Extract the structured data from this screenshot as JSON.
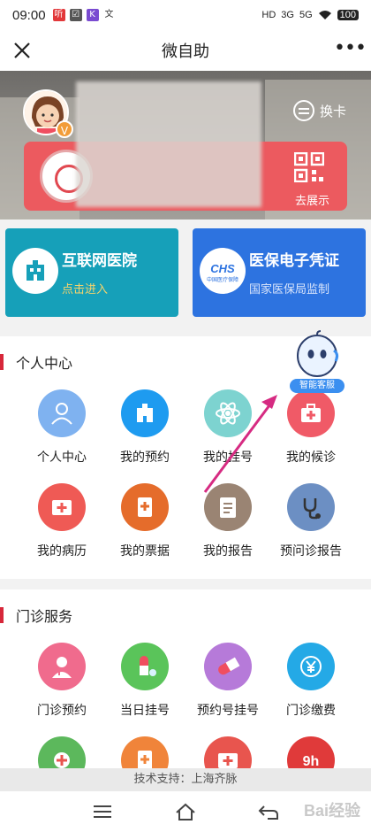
{
  "status_bar": {
    "time": "09:00",
    "notification_icons": [
      "听",
      "☑",
      "K",
      "文"
    ],
    "signal_labels": [
      "HD",
      "3G",
      "5G"
    ],
    "battery": "100"
  },
  "title_bar": {
    "title": "微自助",
    "more_label": "•••"
  },
  "hero": {
    "switch_card_label": "换卡",
    "show_qr_label": "去展示",
    "vip_badge": "V"
  },
  "tiles": [
    {
      "title": "互联网医院",
      "subtitle": "点击进入",
      "logo_text": "",
      "color": "#16a0b9"
    },
    {
      "title": "医保电子凭证",
      "subtitle": "国家医保局监制",
      "logo_text": "CHS",
      "logo_caption": "中国医疗保障",
      "color": "#2d73e0"
    }
  ],
  "personal_center": {
    "heading": "个人中心",
    "items": [
      {
        "label": "个人中心",
        "icon": "user-icon",
        "color": "#7fb2f0"
      },
      {
        "label": "我的预约",
        "icon": "hospital-building-icon",
        "color": "#1e9bf0"
      },
      {
        "label": "我的挂号",
        "icon": "atom-icon",
        "color": "#7dd3d0"
      },
      {
        "label": "我的候诊",
        "icon": "medical-kit-icon",
        "color": "#f05a67"
      },
      {
        "label": "我的病历",
        "icon": "medical-record-icon",
        "color": "#ef5a55"
      },
      {
        "label": "我的票据",
        "icon": "receipt-icon",
        "color": "#e56c2b"
      },
      {
        "label": "我的报告",
        "icon": "report-clipboard-icon",
        "color": "#9a8473"
      },
      {
        "label": "预问诊报告",
        "icon": "stethoscope-icon",
        "color": "#6c8fc3"
      }
    ]
  },
  "outpatient_service": {
    "heading": "门诊服务",
    "items": [
      {
        "label": "门诊预约",
        "icon": "doctor-icon",
        "color": "#f06b8d"
      },
      {
        "label": "当日挂号",
        "icon": "pill-icon",
        "color": "#5ac45a"
      },
      {
        "label": "预约号挂号",
        "icon": "capsule-icon",
        "color": "#b67ad9"
      },
      {
        "label": "门诊缴费",
        "icon": "yuan-coin-icon",
        "color": "#24a9e6"
      },
      {
        "label": "",
        "icon": "health-care-icon",
        "color": "#5cb85c"
      },
      {
        "label": "",
        "icon": "clipboard-plus-icon",
        "color": "#f0843a"
      },
      {
        "label": "",
        "icon": "first-aid-icon",
        "color": "#e8554e"
      },
      {
        "label": "",
        "icon": "delivery-icon",
        "color": "#e03a3a"
      }
    ]
  },
  "assistant": {
    "label": "智能客服"
  },
  "footer": {
    "support_text": "技术支持：上海齐脉"
  },
  "watermark": "Bai经验"
}
